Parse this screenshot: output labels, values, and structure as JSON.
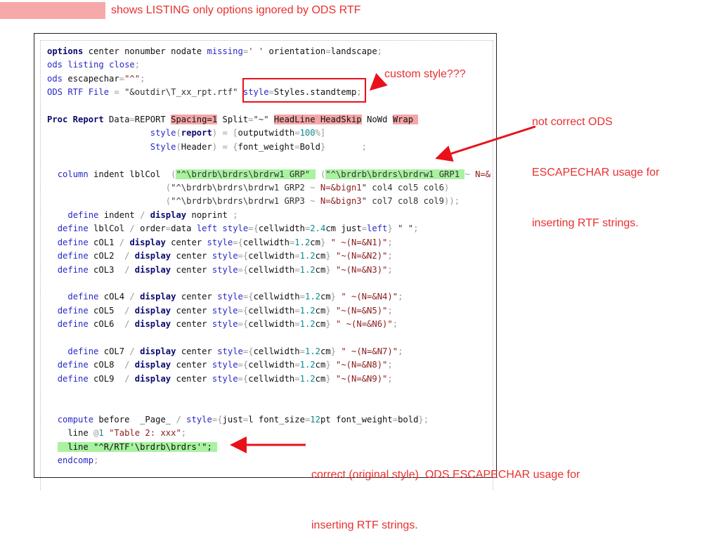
{
  "banner": {
    "text": "shows LISTING only options ignored by ODS RTF",
    "highlight_color": "#f7a8a8"
  },
  "annotations": {
    "custom_style": "custom style???",
    "incorrect": [
      "not correct ODS",
      "ESCAPECHAR usage for",
      "inserting RTF strings."
    ],
    "correct": [
      "correct (original style)  ODS ESCAPECHAR usage for",
      "inserting RTF strings."
    ],
    "color": "#e8312f"
  },
  "code": [
    [
      [
        "options",
        "b"
      ],
      [
        " center nonumber nodate ",
        "t"
      ],
      [
        "missing",
        "k"
      ],
      [
        "=",
        "p"
      ],
      [
        "' '",
        "s"
      ],
      [
        " orientation",
        "t"
      ],
      [
        "=",
        "p"
      ],
      [
        "landscape",
        "t"
      ],
      [
        ";",
        "p"
      ]
    ],
    [
      [
        "ods",
        "k"
      ],
      [
        " ",
        "t"
      ],
      [
        "listing",
        "k"
      ],
      [
        " ",
        "t"
      ],
      [
        "close",
        "k"
      ],
      [
        ";",
        "p"
      ]
    ],
    [
      [
        "ods",
        "k"
      ],
      [
        " escapechar",
        "t"
      ],
      [
        "=",
        "p"
      ],
      [
        "\"^\"",
        "s"
      ],
      [
        ";",
        "p"
      ]
    ],
    [
      [
        "ODS RTF File",
        "k"
      ],
      [
        " = ",
        "p"
      ],
      [
        "\"&outdir\\T_xx_rpt.rtf\"",
        "q"
      ],
      [
        " ",
        "t"
      ],
      [
        "style",
        "k"
      ],
      [
        "=",
        "p"
      ],
      [
        "Styles.standtemp",
        "t"
      ],
      [
        ";",
        "p"
      ]
    ],
    [],
    [
      [
        "Proc Report",
        "b"
      ],
      [
        " Data",
        "t"
      ],
      [
        "=",
        "p"
      ],
      [
        "REPORT ",
        "t"
      ],
      [
        "Spacing=1",
        "t hp"
      ],
      [
        " Split",
        "t"
      ],
      [
        "=",
        "p"
      ],
      [
        "\"~\"",
        "q"
      ],
      [
        " ",
        "t"
      ],
      [
        "HeadLine HeadSkip",
        "t hp"
      ],
      [
        " NoWd ",
        "t"
      ],
      [
        "Wrap ",
        "t hp"
      ]
    ],
    [
      [
        "                    ",
        "t"
      ],
      [
        "style",
        "k"
      ],
      [
        "(",
        "p"
      ],
      [
        "report",
        "b"
      ],
      [
        ")",
        "p"
      ],
      [
        " = ",
        "p"
      ],
      [
        "[",
        "p"
      ],
      [
        "outputwidth",
        "t"
      ],
      [
        "=",
        "p"
      ],
      [
        "100",
        "n"
      ],
      [
        "%]",
        "p"
      ]
    ],
    [
      [
        "                    ",
        "t"
      ],
      [
        "Style",
        "k"
      ],
      [
        "(",
        "p"
      ],
      [
        "Header",
        "t"
      ],
      [
        ")",
        "p"
      ],
      [
        " = ",
        "p"
      ],
      [
        "{",
        "p"
      ],
      [
        "font_weight",
        "t"
      ],
      [
        "=",
        "p"
      ],
      [
        "Bold",
        "t"
      ],
      [
        "}",
        "p"
      ],
      [
        "       ;",
        "p"
      ]
    ],
    [],
    [
      [
        "  ",
        "t"
      ],
      [
        "column",
        "k"
      ],
      [
        " indent lblCol  ",
        "t"
      ],
      [
        "(",
        "p"
      ],
      [
        "\"^\\brdrb\\brdrs\\brdrw1 GRP\" ",
        "q hg"
      ],
      [
        " ",
        "t"
      ],
      [
        "(",
        "p"
      ],
      [
        "\"^\\brdrb\\brdrs\\brdrw1 GRP1 ",
        "q hg"
      ],
      [
        "~ ",
        "p"
      ],
      [
        "N=&",
        "s"
      ]
    ],
    [
      [
        "                       ",
        "t"
      ],
      [
        "(",
        "p"
      ],
      [
        "\"^\\brdrb\\brdrs\\brdrw1 GRP2 ",
        "q"
      ],
      [
        "~ ",
        "p"
      ],
      [
        "N=&bign1",
        "s"
      ],
      [
        "\" col4 col5 col6",
        "q"
      ],
      [
        ")",
        "p"
      ]
    ],
    [
      [
        "                       ",
        "t"
      ],
      [
        "(",
        "p"
      ],
      [
        "\"^\\brdrb\\brdrs\\brdrw1 GRP3 ",
        "q"
      ],
      [
        "~ ",
        "p"
      ],
      [
        "N=&bign3",
        "s"
      ],
      [
        "\" col7 col8 col9",
        "q"
      ],
      [
        "));",
        "p"
      ]
    ],
    [
      [
        "    ",
        "t"
      ],
      [
        "define",
        "k"
      ],
      [
        " indent ",
        "t"
      ],
      [
        "/",
        "p"
      ],
      [
        " ",
        "t"
      ],
      [
        "display",
        "b"
      ],
      [
        " noprint ",
        "t"
      ],
      [
        ";",
        "p"
      ]
    ],
    [
      [
        "  ",
        "t"
      ],
      [
        "define",
        "k"
      ],
      [
        " lblCol ",
        "t"
      ],
      [
        "/",
        "p"
      ],
      [
        " order",
        "t"
      ],
      [
        "=",
        "p"
      ],
      [
        "data ",
        "t"
      ],
      [
        "left",
        "k"
      ],
      [
        " ",
        "t"
      ],
      [
        "style",
        "k"
      ],
      [
        "=",
        "p"
      ],
      [
        "{",
        "p"
      ],
      [
        "cellwidth",
        "t"
      ],
      [
        "=",
        "p"
      ],
      [
        "2.4",
        "n"
      ],
      [
        "cm just",
        "t"
      ],
      [
        "=",
        "p"
      ],
      [
        "left",
        "k"
      ],
      [
        "}",
        "p"
      ],
      [
        " \" \"",
        "q"
      ],
      [
        ";",
        "p"
      ]
    ],
    [
      [
        "  ",
        "t"
      ],
      [
        "define",
        "k"
      ],
      [
        " cOL1 ",
        "t"
      ],
      [
        "/",
        "p"
      ],
      [
        " ",
        "t"
      ],
      [
        "display",
        "b"
      ],
      [
        " center ",
        "t"
      ],
      [
        "style",
        "k"
      ],
      [
        "=",
        "p"
      ],
      [
        "{",
        "p"
      ],
      [
        "cellwidth",
        "t"
      ],
      [
        "=",
        "p"
      ],
      [
        "1.2",
        "n"
      ],
      [
        "cm",
        "t"
      ],
      [
        "}",
        "p"
      ],
      [
        " \" ~(N=&N1)\"",
        "s"
      ],
      [
        ";",
        "p"
      ]
    ],
    [
      [
        "  ",
        "t"
      ],
      [
        "define",
        "k"
      ],
      [
        " cOL2  ",
        "t"
      ],
      [
        "/",
        "p"
      ],
      [
        " ",
        "t"
      ],
      [
        "display",
        "b"
      ],
      [
        " center ",
        "t"
      ],
      [
        "style",
        "k"
      ],
      [
        "=",
        "p"
      ],
      [
        "{",
        "p"
      ],
      [
        "cellwidth",
        "t"
      ],
      [
        "=",
        "p"
      ],
      [
        "1.2",
        "n"
      ],
      [
        "cm",
        "t"
      ],
      [
        "}",
        "p"
      ],
      [
        " \"~(N=&N2)\"",
        "s"
      ],
      [
        ";",
        "p"
      ]
    ],
    [
      [
        "  ",
        "t"
      ],
      [
        "define",
        "k"
      ],
      [
        " cOL3  ",
        "t"
      ],
      [
        "/",
        "p"
      ],
      [
        " ",
        "t"
      ],
      [
        "display",
        "b"
      ],
      [
        " center ",
        "t"
      ],
      [
        "style",
        "k"
      ],
      [
        "=",
        "p"
      ],
      [
        "{",
        "p"
      ],
      [
        "cellwidth",
        "t"
      ],
      [
        "=",
        "p"
      ],
      [
        "1.2",
        "n"
      ],
      [
        "cm",
        "t"
      ],
      [
        "}",
        "p"
      ],
      [
        " \"~(N=&N3)\"",
        "s"
      ],
      [
        ";",
        "p"
      ]
    ],
    [],
    [
      [
        "    ",
        "t"
      ],
      [
        "define",
        "k"
      ],
      [
        " cOL4 ",
        "t"
      ],
      [
        "/",
        "p"
      ],
      [
        " ",
        "t"
      ],
      [
        "display",
        "b"
      ],
      [
        " center ",
        "t"
      ],
      [
        "style",
        "k"
      ],
      [
        "=",
        "p"
      ],
      [
        "{",
        "p"
      ],
      [
        "cellwidth",
        "t"
      ],
      [
        "=",
        "p"
      ],
      [
        "1.2",
        "n"
      ],
      [
        "cm",
        "t"
      ],
      [
        "}",
        "p"
      ],
      [
        " \" ~(N=&N4)\"",
        "s"
      ],
      [
        ";",
        "p"
      ]
    ],
    [
      [
        "  ",
        "t"
      ],
      [
        "define",
        "k"
      ],
      [
        " cOL5  ",
        "t"
      ],
      [
        "/",
        "p"
      ],
      [
        " ",
        "t"
      ],
      [
        "display",
        "b"
      ],
      [
        " center ",
        "t"
      ],
      [
        "style",
        "k"
      ],
      [
        "=",
        "p"
      ],
      [
        "{",
        "p"
      ],
      [
        "cellwidth",
        "t"
      ],
      [
        "=",
        "p"
      ],
      [
        "1.2",
        "n"
      ],
      [
        "cm",
        "t"
      ],
      [
        "}",
        "p"
      ],
      [
        " \"~(N=&N5)\"",
        "s"
      ],
      [
        ";",
        "p"
      ]
    ],
    [
      [
        "  ",
        "t"
      ],
      [
        "define",
        "k"
      ],
      [
        " cOL6  ",
        "t"
      ],
      [
        "/",
        "p"
      ],
      [
        " ",
        "t"
      ],
      [
        "display",
        "b"
      ],
      [
        " center ",
        "t"
      ],
      [
        "style",
        "k"
      ],
      [
        "=",
        "p"
      ],
      [
        "{",
        "p"
      ],
      [
        "cellwidth",
        "t"
      ],
      [
        "=",
        "p"
      ],
      [
        "1.2",
        "n"
      ],
      [
        "cm",
        "t"
      ],
      [
        "}",
        "p"
      ],
      [
        " \" ~(N=&N6)\"",
        "s"
      ],
      [
        ";",
        "p"
      ]
    ],
    [],
    [
      [
        "    ",
        "t"
      ],
      [
        "define",
        "k"
      ],
      [
        " cOL7 ",
        "t"
      ],
      [
        "/",
        "p"
      ],
      [
        " ",
        "t"
      ],
      [
        "display",
        "b"
      ],
      [
        " center ",
        "t"
      ],
      [
        "style",
        "k"
      ],
      [
        "=",
        "p"
      ],
      [
        "{",
        "p"
      ],
      [
        "cellwidth",
        "t"
      ],
      [
        "=",
        "p"
      ],
      [
        "1.2",
        "n"
      ],
      [
        "cm",
        "t"
      ],
      [
        "}",
        "p"
      ],
      [
        " \" ~(N=&N7)\"",
        "s"
      ],
      [
        ";",
        "p"
      ]
    ],
    [
      [
        "  ",
        "t"
      ],
      [
        "define",
        "k"
      ],
      [
        " cOL8  ",
        "t"
      ],
      [
        "/",
        "p"
      ],
      [
        " ",
        "t"
      ],
      [
        "display",
        "b"
      ],
      [
        " center ",
        "t"
      ],
      [
        "style",
        "k"
      ],
      [
        "=",
        "p"
      ],
      [
        "{",
        "p"
      ],
      [
        "cellwidth",
        "t"
      ],
      [
        "=",
        "p"
      ],
      [
        "1.2",
        "n"
      ],
      [
        "cm",
        "t"
      ],
      [
        "}",
        "p"
      ],
      [
        " \"~(N=&N8)\"",
        "s"
      ],
      [
        ";",
        "p"
      ]
    ],
    [
      [
        "  ",
        "t"
      ],
      [
        "define",
        "k"
      ],
      [
        " cOL9  ",
        "t"
      ],
      [
        "/",
        "p"
      ],
      [
        " ",
        "t"
      ],
      [
        "display",
        "b"
      ],
      [
        " center ",
        "t"
      ],
      [
        "style",
        "k"
      ],
      [
        "=",
        "p"
      ],
      [
        "{",
        "p"
      ],
      [
        "cellwidth",
        "t"
      ],
      [
        "=",
        "p"
      ],
      [
        "1.2",
        "n"
      ],
      [
        "cm",
        "t"
      ],
      [
        "}",
        "p"
      ],
      [
        " \"~(N=&N9)\"",
        "s"
      ],
      [
        ";",
        "p"
      ]
    ],
    [],
    [],
    [
      [
        "  ",
        "t"
      ],
      [
        "compute",
        "k"
      ],
      [
        " before  _Page_ ",
        "t"
      ],
      [
        "/",
        "p"
      ],
      [
        " ",
        "t"
      ],
      [
        "style",
        "k"
      ],
      [
        "=",
        "p"
      ],
      [
        "{",
        "p"
      ],
      [
        "just",
        "t"
      ],
      [
        "=",
        "p"
      ],
      [
        "l font_size",
        "t"
      ],
      [
        "=",
        "p"
      ],
      [
        "12",
        "n"
      ],
      [
        "pt font_weight",
        "t"
      ],
      [
        "=",
        "p"
      ],
      [
        "bold",
        "t"
      ],
      [
        "}",
        "p"
      ],
      [
        ";",
        "p"
      ]
    ],
    [
      [
        "    line ",
        "t"
      ],
      [
        "@",
        "p"
      ],
      [
        "1",
        "n"
      ],
      [
        " \"Table 2: xxx\"",
        "s"
      ],
      [
        ";",
        "p"
      ]
    ],
    [
      [
        "  ",
        "t"
      ],
      [
        "  line \"^R/RTF'\\brdrb\\brdrs'\"; ",
        "t hg"
      ]
    ],
    [
      [
        "  ",
        "t"
      ],
      [
        "endcomp",
        "k"
      ],
      [
        ";",
        "p"
      ]
    ]
  ]
}
